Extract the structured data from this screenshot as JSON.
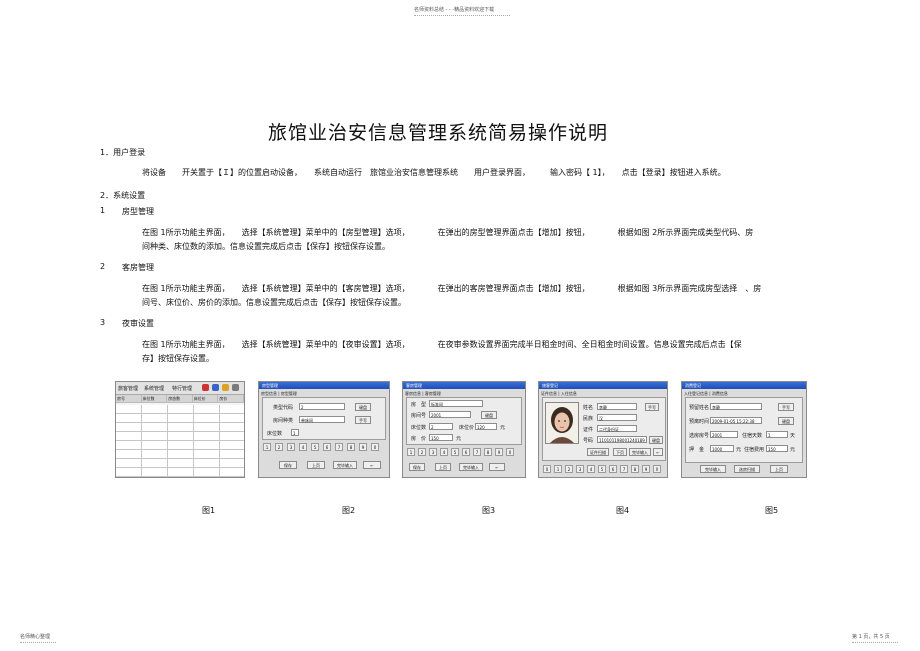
{
  "header": {
    "text": "名师资料总结 - - -精品资料欢迎下载"
  },
  "title": "旅馆业治安信息管理系统简易操作说明",
  "section1": {
    "heading": "1．用户登录",
    "body": "将设备　　开关置于【Ｉ】的位置启动设备，　　系统自动运行　旅馆业治安信息管理系统　　用户登录界面，　　　输入密码【 1】，　　点击【登录】按钮进入系统。"
  },
  "section2": {
    "heading": "2．系统设置",
    "items": [
      {
        "num": "1",
        "title": "房型管理",
        "line1": "在图 1所示功能主界面，　　选择【系统管理】菜单中的【房型管理】选项，　　　　在弹出的房型管理界面点击【增加】按钮，　　　　根据如图 2所示界面完成类型代码、房",
        "line2": "间种类、床位数的添加。信息设置完成后点击【保存】按钮保存设置。"
      },
      {
        "num": "2",
        "title": "客房管理",
        "line1": "在图 1所示功能主界面，　　选择【系统管理】菜单中的【客房管理】选项，　　　　在弹出的客房管理界面点击【增加】按钮，　　　　根据如图 3所示界面完成房型选择　、房",
        "line2": "间号、床位价、房价的添加。信息设置完成后点击【保存】按钮保存设置。"
      },
      {
        "num": "3",
        "title": "夜审设置",
        "line1": "在图 1所示功能主界面，　　选择【系统管理】菜单中的【夜审设置】选项，　　　　在夜审参数设置界面完成半日租金时间、全日租金时间设置。信息设置完成后点击【保",
        "line2": "存】按钮保存设置。"
      }
    ]
  },
  "figures": {
    "captions": [
      "图1",
      "图2",
      "图3",
      "图4",
      "图5"
    ],
    "fig1": {
      "menu": [
        "旅客管理",
        "系统管理",
        "特行管理"
      ],
      "columns": [
        "房号",
        "床位数",
        "房态数",
        "床位价",
        "房价"
      ]
    },
    "fig2": {
      "title": "房型管理",
      "tabs": "房型信息 | 房型管理",
      "labels": [
        "类型代码",
        "房间种类",
        "床位数"
      ],
      "values": [
        "2",
        "单床间",
        "1"
      ],
      "side_buttons": [
        "键盘",
        "手写"
      ],
      "keys": [
        "1",
        "2",
        "3",
        "4",
        "5",
        "6",
        "7",
        "8",
        "9",
        "0"
      ],
      "buttons": [
        "保存",
        "上页",
        "完毕输入",
        "←"
      ]
    },
    "fig3": {
      "title": "客房管理",
      "tabs": "客房信息 | 客房管理",
      "labels": [
        "房　型",
        "房间号",
        "床位数",
        "房　价"
      ],
      "values": [
        "标准间",
        "2001",
        "2",
        "150"
      ],
      "bed_price_label": "床位价",
      "bed_price": "120",
      "unit": "元",
      "side_button": "键盘",
      "keys": [
        "1",
        "2",
        "3",
        "4",
        "5",
        "6",
        "7",
        "8",
        "9",
        "0"
      ],
      "buttons": [
        "保存",
        "上页",
        "完毕输入",
        "←"
      ]
    },
    "fig4": {
      "title": "旅客登记",
      "tabs": "证件信息 | 入住信息",
      "labels": [
        "姓名",
        "民族",
        "证件",
        "号码"
      ],
      "values": [
        "李静",
        "汉",
        "二代身份证",
        "110101198001240189"
      ],
      "side_buttons": [
        "手写",
        "键盘"
      ],
      "buttons": [
        "证件扫描",
        "下页",
        "完毕输入",
        "←"
      ],
      "keys": [
        "0",
        "1",
        "2",
        "3",
        "4",
        "5",
        "6",
        "7",
        "8",
        "9",
        "X"
      ]
    },
    "fig5": {
      "title": "消费登记",
      "tabs": "入住登记信息 | 消费信息",
      "labels": [
        "预留姓名",
        "预离时间",
        "选房房号",
        "押　金",
        "住宿天数",
        "住宿费用"
      ],
      "values": [
        "李静",
        "2009-01-05 15:22:38",
        "2001",
        "1000",
        "1",
        "150"
      ],
      "unit": "元",
      "side_buttons": [
        "手写",
        "键盘"
      ],
      "buttons": [
        "完毕输入",
        "选房扫描",
        "上页"
      ]
    }
  },
  "footer": {
    "left": "名师精心整理",
    "right": "第 1 页，共 5 页"
  }
}
